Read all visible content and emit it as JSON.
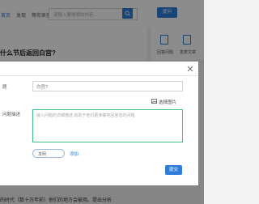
{
  "nav": {
    "items": [
      {
        "label": "首页"
      },
      {
        "label": "发现"
      },
      {
        "label": "等你来答"
      }
    ],
    "search_placeholder": "请输入要搜索的内容...",
    "ask_label": "提问"
  },
  "side_panel": {
    "items": [
      {
        "label": "回答问题",
        "icon": "document-icon"
      },
      {
        "label": "发表文章",
        "icon": "edit-icon"
      }
    ]
  },
  "question": {
    "title": "什么节后返回白宫?"
  },
  "modal": {
    "title_label": "题",
    "title_value": "白宫?",
    "image_link": "选择图片",
    "desc_label": "问题描述",
    "desc_placeholder": "输入问题的详细描述,有助于他们更准确地回答您的问题",
    "tag_value": "发明",
    "add_label": "添加",
    "submit_label": "提交"
  },
  "bottom": {
    "text": "的时代（数十万年前）他们的地方会被用。提出分析"
  },
  "colors": {
    "accent": "#2f7dd8",
    "focus_border": "#3fbf86",
    "overlay": "rgba(0,0,0,0.45)"
  }
}
